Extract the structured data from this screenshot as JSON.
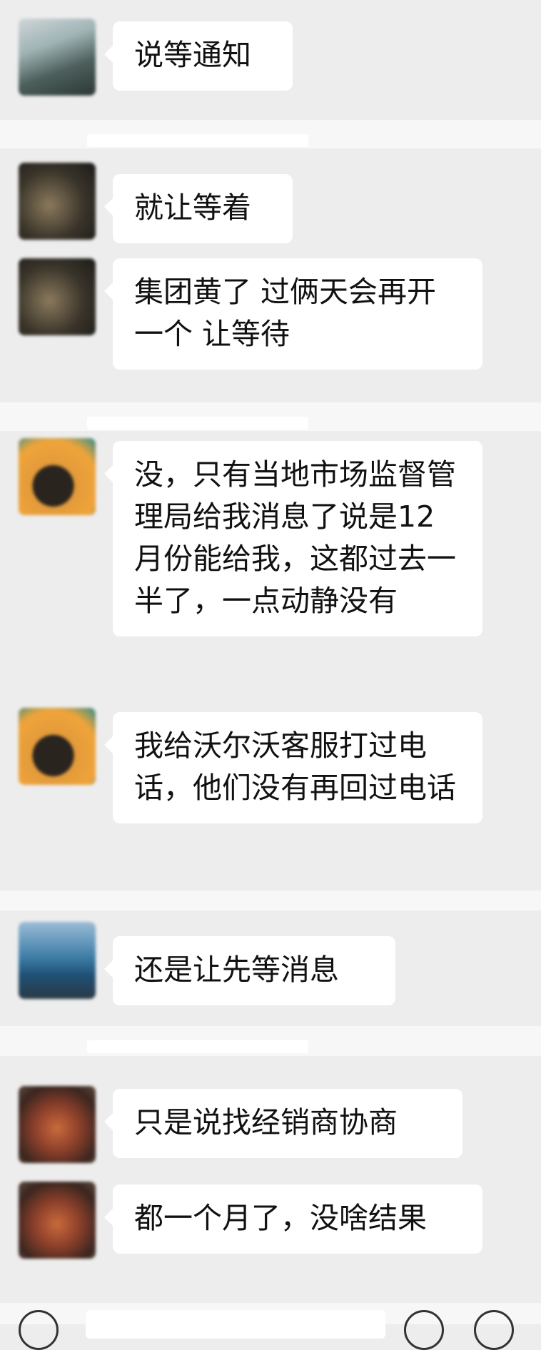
{
  "messages": [
    {
      "text": "说等通知"
    },
    {
      "text": "就让等着"
    },
    {
      "text": "集团黄了 过俩天会再开一个 让等待"
    },
    {
      "text": "没，只有当地市场监督管理局给我消息了说是12月份能给我，这都过去一半了，一点动静没有"
    },
    {
      "text": "我给沃尔沃客服打过电话，他们没有再回过电话"
    },
    {
      "text": "还是让先等消息"
    },
    {
      "text": "只是说找经销商协商"
    },
    {
      "text": "都一个月了，没啥结果"
    }
  ],
  "icons": {
    "voice": "voice-icon",
    "emoji": "emoji-icon",
    "add": "add-icon"
  },
  "colors": {
    "background": "#ededed",
    "bubble": "#ffffff",
    "divider": "#f7f7f7",
    "text": "#111111"
  }
}
